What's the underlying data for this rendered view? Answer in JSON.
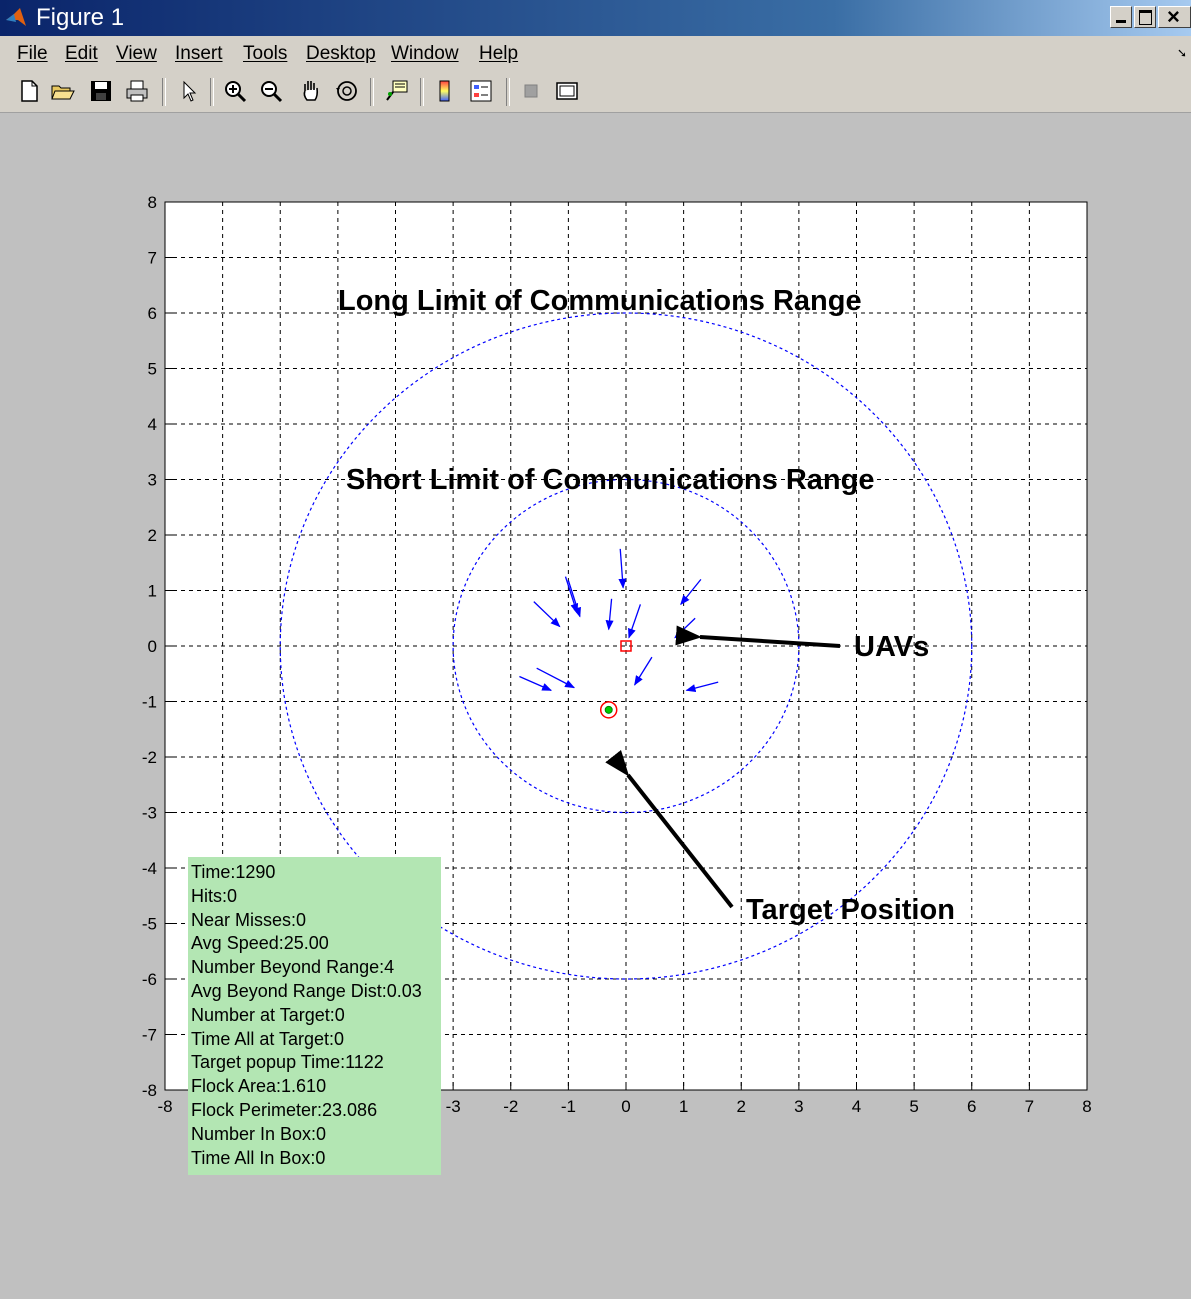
{
  "window": {
    "title": "Figure 1"
  },
  "menubar": {
    "items": [
      {
        "label": "File"
      },
      {
        "label": "Edit"
      },
      {
        "label": "View"
      },
      {
        "label": "Insert"
      },
      {
        "label": "Tools"
      },
      {
        "label": "Desktop"
      },
      {
        "label": "Window"
      },
      {
        "label": "Help"
      }
    ]
  },
  "toolbar": {
    "buttons": [
      "new-figure-icon",
      "open-file-icon",
      "save-icon",
      "print-icon",
      "edit-plot-arrow-icon",
      "zoom-in-icon",
      "zoom-out-icon",
      "pan-hand-icon",
      "rotate-3d-icon",
      "data-cursor-icon",
      "insert-colorbar-icon",
      "insert-legend-icon",
      "hide-plot-tools-icon",
      "show-plot-tools-icon"
    ]
  },
  "annotations": {
    "long_limit": "Long Limit of Communications Range",
    "short_limit": "Short Limit of Communications Range",
    "uavs": "UAVs",
    "target_position": "Target Position"
  },
  "stats": {
    "time": "Time:1290",
    "hits": "Hits:0",
    "near_misses": "Near Misses:0",
    "avg_speed": "Avg Speed:25.00",
    "number_beyond_range": "Number Beyond Range:4",
    "avg_beyond_range_dist": "Avg Beyond Range Dist:0.03",
    "number_at_target": "Number at Target:0",
    "time_all_at_target": "Time All at Target:0",
    "target_popup_time": "Target popup Time:1122",
    "flock_area": "Flock Area:1.610",
    "flock_perimeter": "Flock Perimeter:23.086",
    "number_in_box": "Number In Box:0",
    "time_all_in_box": "Time All In Box:0"
  },
  "colors": {
    "uav": "#0000ff",
    "range_circle": "#0000ff",
    "target_marker": "#ff0000",
    "target_fill": "#00cc00",
    "stats_background": "#b3e6b3"
  },
  "chart_data": {
    "type": "scatter",
    "xlim": [
      -8,
      8
    ],
    "ylim": [
      -8,
      8
    ],
    "xticks": [
      -8,
      -7,
      -6,
      -5,
      -4,
      -3,
      -2,
      -1,
      0,
      1,
      2,
      3,
      4,
      5,
      6,
      7,
      8
    ],
    "yticks": [
      -8,
      -7,
      -6,
      -5,
      -4,
      -3,
      -2,
      -1,
      0,
      1,
      2,
      3,
      4,
      5,
      6,
      7,
      8
    ],
    "grid": true,
    "circles": [
      {
        "cx": 0,
        "cy": 0,
        "r": 6,
        "style": "dashed"
      },
      {
        "cx": 0,
        "cy": 0,
        "r": 3,
        "style": "dashed"
      }
    ],
    "uavs": [
      {
        "x": -0.1,
        "y": 1.75,
        "dx": 0.05,
        "dy": -0.7
      },
      {
        "x": -1.05,
        "y": 1.25,
        "dx": 0.2,
        "dy": -0.65
      },
      {
        "x": -1.0,
        "y": 1.18,
        "dx": 0.2,
        "dy": -0.65
      },
      {
        "x": -1.6,
        "y": 0.8,
        "dx": 0.45,
        "dy": -0.45
      },
      {
        "x": -0.25,
        "y": 0.85,
        "dx": -0.05,
        "dy": -0.55
      },
      {
        "x": 0.25,
        "y": 0.75,
        "dx": -0.2,
        "dy": -0.6
      },
      {
        "x": 1.3,
        "y": 1.2,
        "dx": -0.35,
        "dy": -0.45
      },
      {
        "x": 1.2,
        "y": 0.5,
        "dx": -0.35,
        "dy": -0.35
      },
      {
        "x": 0.45,
        "y": -0.2,
        "dx": -0.3,
        "dy": -0.5
      },
      {
        "x": -1.55,
        "y": -0.4,
        "dx": 0.65,
        "dy": -0.35
      },
      {
        "x": -1.85,
        "y": -0.55,
        "dx": 0.55,
        "dy": -0.25
      },
      {
        "x": 1.6,
        "y": -0.65,
        "dx": -0.55,
        "dy": -0.15
      }
    ],
    "center_marker": {
      "x": 0,
      "y": 0
    },
    "target": {
      "x": -0.3,
      "y": -1.15
    }
  }
}
